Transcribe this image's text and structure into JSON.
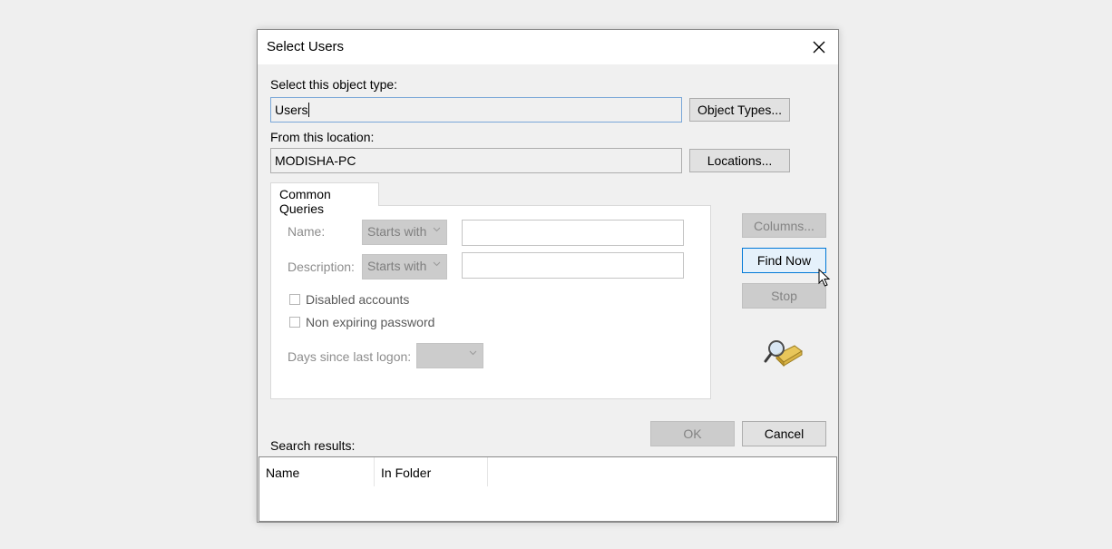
{
  "dialog": {
    "title": "Select Users",
    "object_type_label": "Select this object type:",
    "object_type_value": "Users",
    "object_types_button": "Object Types...",
    "location_label": "From this location:",
    "location_value": "MODISHA-PC",
    "locations_button": "Locations...",
    "tab_label": "Common Queries",
    "name_label": "Name:",
    "name_operator": "Starts with",
    "description_label": "Description:",
    "description_operator": "Starts with",
    "disabled_accounts_label": "Disabled accounts",
    "non_expiring_label": "Non expiring password",
    "days_label": "Days since last logon:",
    "days_value": "",
    "columns_button": "Columns...",
    "find_now_button": "Find Now",
    "stop_button": "Stop",
    "ok_button": "OK",
    "cancel_button": "Cancel",
    "search_results_label": "Search results:",
    "results_columns": [
      "Name",
      "In Folder"
    ]
  },
  "icons": {
    "close": "close-icon",
    "search_graphic": "search-magnifier-icon",
    "dropdown": "chevron-down-icon",
    "cursor": "mouse-pointer-icon"
  },
  "colors": {
    "focus_border": "#7aa7d8",
    "hover_button_border": "#0078d7",
    "hover_button_bg": "#e5f1fb"
  }
}
